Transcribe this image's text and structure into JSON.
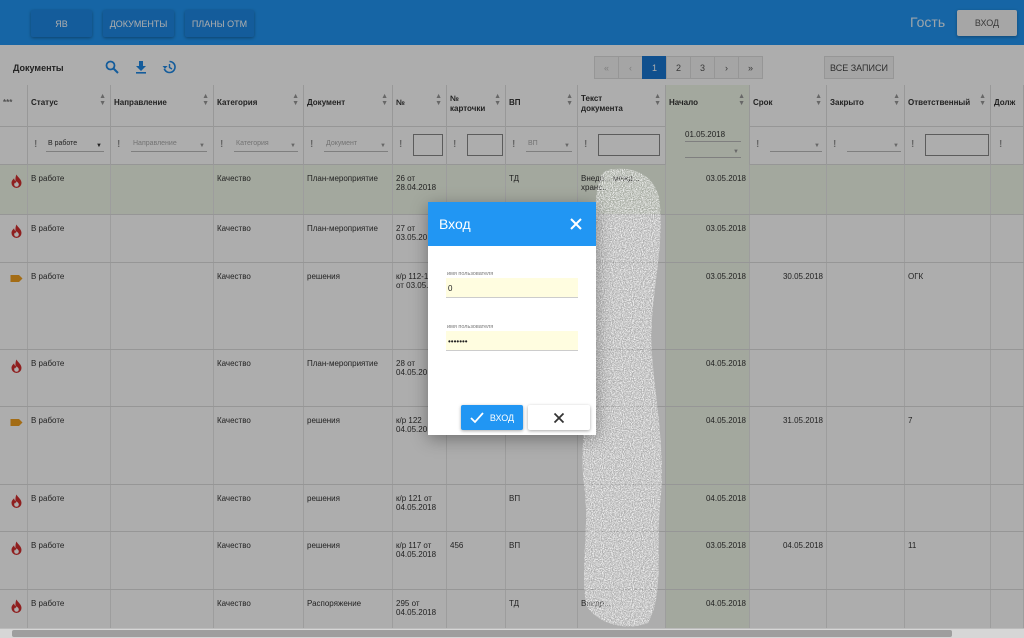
{
  "topbar": {
    "buttons": [
      "ЯВ",
      "ДОКУМЕНТЫ",
      "ПЛАНЫ ОТМ"
    ],
    "guest_label": "Гость",
    "login_label": "ВХОД"
  },
  "toolbar": {
    "title": "Документы",
    "icons": [
      "search-icon",
      "download-icon",
      "history-icon"
    ],
    "pager": [
      "«",
      "‹",
      "1",
      "2",
      "3",
      "›",
      "»"
    ],
    "active_page": "1",
    "all_records_label": "ВСЕ ЗАПИСИ"
  },
  "table": {
    "corner": "***",
    "columns": [
      "Статус",
      "Направление",
      "Категория",
      "Документ",
      "№",
      "№ карточки",
      "ВП",
      "Текст документа",
      "Начало",
      "Срок",
      "Закрыто",
      "Ответственный",
      "Долж"
    ],
    "filters": {
      "status": "В работе",
      "direction_placeholder": "Направление",
      "category_placeholder": "Категория",
      "document_placeholder": "Документ",
      "vp_placeholder": "ВП",
      "start_date": "01.05.2018"
    },
    "rows": [
      {
        "icon": "fire-icon",
        "status": "В работе",
        "category": "Качество",
        "document": "План-мероприятие",
        "number": "26 от 28.04.2018",
        "card": "",
        "vp": "ТД",
        "text": "Внедр... межд... хранс...",
        "start": "03.05.2018",
        "deadline": "",
        "closed": "",
        "responsible": ""
      },
      {
        "icon": "fire-icon",
        "status": "В работе",
        "category": "Качество",
        "document": "План-мероприятие",
        "number": "27 от 03.05.20",
        "card": "",
        "vp": "",
        "text": "",
        "start": "03.05.2018",
        "deadline": "",
        "closed": "",
        "responsible": ""
      },
      {
        "icon": "tag-icon",
        "status": "В работе",
        "category": "Качество",
        "document": "решения",
        "number": "к/р 112-116 от 03.05.20",
        "card": "",
        "vp": "",
        "text": "",
        "start": "03.05.2018",
        "deadline": "30.05.2018",
        "closed": "",
        "responsible": "ОГК"
      },
      {
        "icon": "fire-icon",
        "status": "В работе",
        "category": "Качество",
        "document": "План-мероприятие",
        "number": "28 от 04.05.20",
        "card": "",
        "vp": "",
        "text": "",
        "start": "04.05.2018",
        "deadline": "",
        "closed": "",
        "responsible": ""
      },
      {
        "icon": "tag-icon",
        "status": "В работе",
        "category": "Качество",
        "document": "решения",
        "number": "к/р 122 04.05.20",
        "card": "",
        "vp": "",
        "text": "",
        "start": "04.05.2018",
        "deadline": "31.05.2018",
        "closed": "",
        "responsible": "7"
      },
      {
        "icon": "fire-icon",
        "status": "В работе",
        "category": "Качество",
        "document": "решения",
        "number": "к/р 121 от 04.05.2018",
        "card": "",
        "vp": "ВП",
        "text": "",
        "start": "04.05.2018",
        "deadline": "",
        "closed": "",
        "responsible": ""
      },
      {
        "icon": "fire-icon",
        "status": "В работе",
        "category": "Качество",
        "document": "решения",
        "number": "к/р 117 от 04.05.2018",
        "card": "456",
        "vp": "ВП",
        "text": "",
        "start": "03.05.2018",
        "deadline": "04.05.2018",
        "closed": "",
        "responsible": "11"
      },
      {
        "icon": "fire-icon",
        "status": "В работе",
        "category": "Качество",
        "document": "Распоряжение",
        "number": "295 от 04.05.2018",
        "card": "",
        "vp": "ТД",
        "text": "Внедр...",
        "start": "04.05.2018",
        "deadline": "",
        "closed": "",
        "responsible": ""
      }
    ]
  },
  "dialog": {
    "title": "Вход",
    "username_label": "имя пользователя",
    "username_value": "0",
    "password_label": "имя пользователя",
    "password_value": "•••••••",
    "ok_label": "ВХОД"
  }
}
